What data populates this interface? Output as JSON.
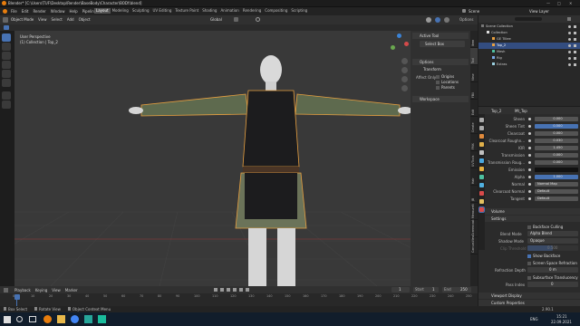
{
  "window": {
    "title": "Blender* [C:\\Users\\TUF\\Desktop\\Render\\BaseBody\\Character\\BODY.blend]"
  },
  "topbar": {
    "menus": [
      "File",
      "Edit",
      "Render",
      "Window",
      "Help",
      "Pipeline"
    ],
    "workspaces": [
      "Layout",
      "Modeling",
      "Sculpting",
      "UV Editing",
      "Texture Paint",
      "Shading",
      "Animation",
      "Rendering",
      "Compositing",
      "Scripting"
    ],
    "active_workspace": "Layout",
    "scene": "Scene",
    "view_layer": "View Layer",
    "options": "Options"
  },
  "viewport_header": {
    "mode": "Object Mode",
    "menus": [
      "View",
      "Select",
      "Add",
      "Object"
    ],
    "orientation": "Global"
  },
  "viewport": {
    "view_name": "User Perspective",
    "collection": "(1) Collection | Top_2"
  },
  "npanel": {
    "tabs": [
      "Item",
      "Tool",
      "View",
      "FBX",
      "Edit",
      "Create",
      "FMX",
      "UVTools",
      "Hair",
      "JB",
      "MeasureIt",
      "Screencast",
      "CanvasView"
    ],
    "active_tool_header": "Active Tool",
    "active_tool_value": "Select Box",
    "options_header": "Options",
    "transform_header": "Transform",
    "affect_only": "Affect Only",
    "checks": [
      "Origins",
      "Locations",
      "Parents"
    ],
    "workspace_header": "Workspace"
  },
  "outliner": {
    "items": [
      {
        "name": "Scene Collection",
        "indent": 0,
        "selected": false
      },
      {
        "name": "Collection",
        "indent": 1,
        "selected": false
      },
      {
        "name": "GE Tillee",
        "indent": 2,
        "selected": false
      },
      {
        "name": "Top_2",
        "indent": 2,
        "selected": true
      },
      {
        "name": "Mesh",
        "indent": 2,
        "selected": false
      },
      {
        "name": "Rig",
        "indent": 2,
        "selected": false
      },
      {
        "name": "Extras",
        "indent": 2,
        "selected": false
      }
    ]
  },
  "properties": {
    "object_name": "Top_2",
    "material_name": "Mt_Top",
    "rows": [
      {
        "label": "Sheen",
        "value": "0.000",
        "style": "gray"
      },
      {
        "label": "Sheen Tint",
        "value": "0.500",
        "style": "blue"
      },
      {
        "label": "Clearcoat",
        "value": "0.000",
        "style": "gray"
      },
      {
        "label": "Clearcoat Roughn...",
        "value": "0.030",
        "style": "gray"
      },
      {
        "label": "IOR",
        "value": "1.450",
        "style": "gray"
      },
      {
        "label": "Transmission",
        "value": "0.000",
        "style": "gray"
      },
      {
        "label": "Transmission Roug...",
        "value": "0.000",
        "style": "gray"
      },
      {
        "label": "Emission",
        "value": "",
        "style": "dark"
      },
      {
        "label": "Alpha",
        "value": "1.000",
        "style": "blue"
      },
      {
        "label": "Normal",
        "value": "Normal Map",
        "style": "gray"
      },
      {
        "label": "Clearcoat Normal",
        "value": "Default",
        "style": "gray"
      },
      {
        "label": "Tangent",
        "value": "Default",
        "style": "gray"
      }
    ],
    "volume_header": "Volume",
    "settings_header": "Settings",
    "backface_culling": "Backface Culling",
    "blend_mode_label": "Blend Mode",
    "blend_mode": "Alpha Blend",
    "shadow_mode_label": "Shadow Mode",
    "shadow_mode": "Opaque",
    "clip_threshold_label": "Clip Threshold",
    "clip_threshold": "0.500",
    "show_backface": "Show Backface",
    "screen_space_refraction": "Screen Space Refraction",
    "refraction_depth_label": "Refraction Depth",
    "refraction_depth": "0 m",
    "subsurface_translucency": "Subsurface Translucency",
    "pass_index_label": "Pass Index",
    "pass_index": "0",
    "viewport_display_header": "Viewport Display",
    "custom_properties_header": "Custom Properties"
  },
  "timeline": {
    "menus": [
      "Playback",
      "Keying",
      "View",
      "Marker"
    ],
    "current_frame": "1",
    "start_label": "Start",
    "start": "1",
    "end_label": "End",
    "end": "250",
    "ticks": [
      "0",
      "10",
      "20",
      "30",
      "40",
      "50",
      "60",
      "70",
      "80",
      "90",
      "100",
      "110",
      "120",
      "130",
      "140",
      "150",
      "160",
      "170",
      "180",
      "190",
      "200",
      "210",
      "220",
      "230",
      "240",
      "250"
    ]
  },
  "statusbar": {
    "left": [
      "Box Select",
      "Rotate View",
      "Object Context Menu"
    ],
    "right": "2.90.1"
  },
  "taskbar": {
    "time": "15:21",
    "date": "22.09.2021",
    "lang": "ENG"
  },
  "colors": {
    "accent": "#4772b3",
    "selection_outline": "#e8a040",
    "tunic": "#1c1c1e",
    "sleeve": "#5e6a4e",
    "skirt": "#6b7359",
    "skin": "#d6d6d6"
  }
}
